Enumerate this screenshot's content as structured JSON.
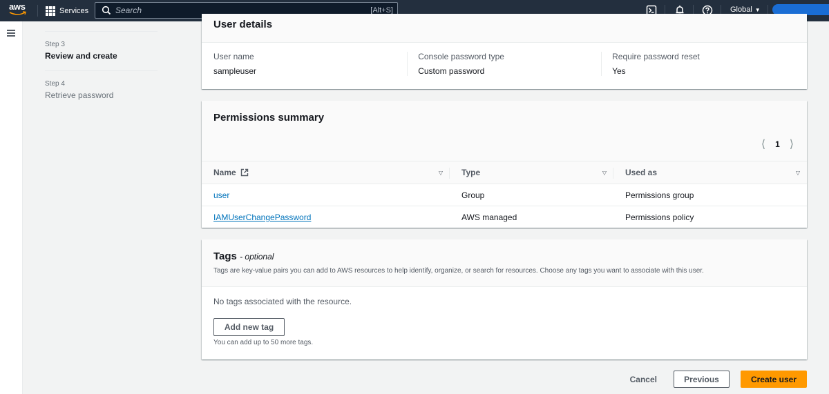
{
  "topnav": {
    "logo_text": "aws",
    "services_label": "Services",
    "search_placeholder": "Search",
    "search_value": "",
    "search_shortcut": "[Alt+S]",
    "region_label": "Global"
  },
  "steps": [
    {
      "num": "Step 3",
      "title": "Review and create",
      "active": true
    },
    {
      "num": "Step 4",
      "title": "Retrieve password",
      "active": false
    }
  ],
  "user_details": {
    "title": "User details",
    "fields": [
      {
        "label": "User name",
        "value": "sampleuser"
      },
      {
        "label": "Console password type",
        "value": "Custom password"
      },
      {
        "label": "Require password reset",
        "value": "Yes"
      }
    ]
  },
  "permissions": {
    "title": "Permissions summary",
    "current_page": "1",
    "columns": [
      "Name",
      "Type",
      "Used as"
    ],
    "rows": [
      {
        "name": "user",
        "type": "Group",
        "used_as": "Permissions group"
      },
      {
        "name": "IAMUserChangePassword",
        "type": "AWS managed",
        "used_as": "Permissions policy"
      }
    ]
  },
  "tags": {
    "title": "Tags",
    "optional": "- optional",
    "description": "Tags are key-value pairs you can add to AWS resources to help identify, organize, or search for resources. Choose any tags you want to associate with this user.",
    "empty_text": "No tags associated with the resource.",
    "add_button": "Add new tag",
    "hint": "You can add up to 50 more tags."
  },
  "actions": {
    "cancel": "Cancel",
    "previous": "Previous",
    "create": "Create user"
  },
  "colors": {
    "nav_bg": "#232f3e",
    "primary": "#ff9900",
    "link": "#0073bb"
  }
}
